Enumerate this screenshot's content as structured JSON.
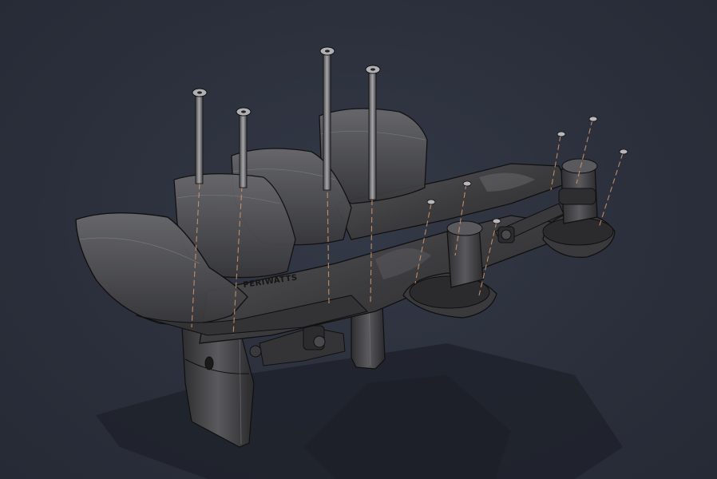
{
  "model": {
    "branding_text": "PERIWATTS"
  },
  "colors": {
    "background": "#2b2f3b",
    "part_body": "#3c3c3e",
    "part_shade": "#2a2a2c",
    "part_highlight": "#6a6a6e",
    "edge_line": "#101010",
    "hidden_line": "#8a8a8e",
    "axis_line": "#d79a6c",
    "shadow": "#1f222b"
  },
  "icons": {
    "bolt": "socket-head-bolt-icon",
    "screw": "small-screw-icon",
    "action_mount": "action-camera-mount-icon"
  }
}
